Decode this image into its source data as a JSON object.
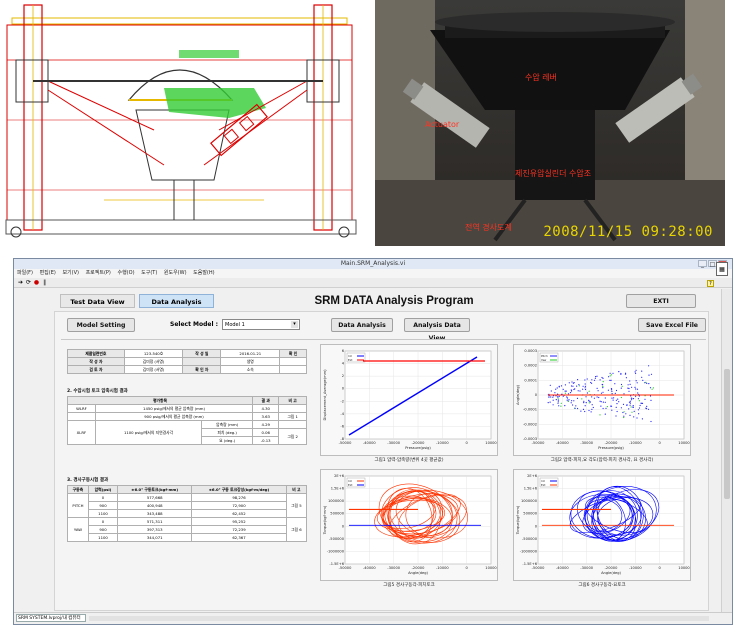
{
  "photo": {
    "label_top": "수압 레버",
    "label_actuator": "Actuator",
    "label_mid": "제진유압실린더 수압조",
    "label_bottom": "전역 경사도계",
    "timestamp": "2008/11/15 09:28:00"
  },
  "window": {
    "title": "Main.SRM_Analysis.vi",
    "menu": [
      "파일(F)",
      "편집(E)",
      "보기(V)",
      "프로젝트(P)",
      "수행(O)",
      "도구(T)",
      "윈도우(W)",
      "도움말(H)"
    ],
    "status_text": "SRM SYSTEM.lvproj/내 컴퓨터"
  },
  "tabs": {
    "test": "Test Data View",
    "analysis": "Data Analysis"
  },
  "program_title": "SRM DATA Analysis Program",
  "exit_label": "EXTI",
  "controls": {
    "model_setting": "Model Setting",
    "select_label": "Select Model :",
    "select_value": "Model 1",
    "data_analysis": "Data Analysis",
    "analysis_data_view": "Analysis Data View",
    "save_excel": "Save Excel File"
  },
  "info_table": {
    "rows": [
      [
        "제품일련번호",
        "123-540호",
        "작 성 일",
        "2016.01.21",
        "확 인"
      ],
      [
        "작 성 자",
        "김미정 (서명)",
        "",
        "생명",
        ""
      ],
      [
        "검 토 자",
        "김미정 (서명)",
        "확 인 자",
        "소속",
        ""
      ]
    ]
  },
  "section2": {
    "title": "2. 수압시험 토크 압축시험 결과",
    "headers": [
      "평가항목",
      "결 과",
      "비 고"
    ],
    "rows": [
      [
        "WLRF",
        "1450 psig/에서의 평균 압축량 (mm)",
        "",
        "4.30",
        ""
      ],
      [
        "",
        "900 psig/에서의 평균 압축량 (mm)",
        "",
        "3.63",
        "그림 1"
      ],
      [
        "XLRF",
        "1100 psig/에서의 지연경사각",
        "압축량 (mm)",
        "4.29",
        ""
      ],
      [
        "",
        "",
        "피치 (deg.)",
        "0.06",
        "그림 2"
      ],
      [
        "",
        "",
        "요 (deg.)",
        "-0.13",
        ""
      ]
    ]
  },
  "section3": {
    "title": "3. 경사구동시험 결과",
    "headers": [
      "구동축",
      "압력(psi)",
      "±6.0° 구동토크(kgf·mm)",
      "±6.0° 구동 토크강성(kgf·m/deg)",
      "비 고"
    ],
    "rows": [
      [
        "",
        "0",
        "577,668",
        "98,276",
        ""
      ],
      [
        "PITCH",
        "900",
        "400,948",
        "72,900",
        "그림 5"
      ],
      [
        "",
        "1100",
        "343,488",
        "62,452",
        ""
      ],
      [
        "",
        "0",
        "571,311",
        "95,252",
        ""
      ],
      [
        "YAW",
        "900",
        "397,313",
        "72,239",
        "그림 6"
      ],
      [
        "",
        "1100",
        "344,071",
        "62,367",
        ""
      ]
    ]
  },
  "plots": [
    {
      "ylabel": "Displacement_Average(mm)",
      "xlabel": "Pressure(psig)",
      "caption": "그림1 압력-압축량(변위 4곳 평균값)",
      "yticks": [
        "6",
        "4",
        "2",
        "0",
        "-2",
        "-4",
        "-6",
        "-8"
      ],
      "xticks": [
        "-50000",
        "-40000",
        "-30000",
        "-20000",
        "-10000",
        "0",
        "10000"
      ],
      "legend": [
        "Int",
        "Ext"
      ],
      "colors": [
        "#0000ff",
        "#ff0000"
      ]
    },
    {
      "ylabel": "Angle(deg)",
      "xlabel": "Pressure(psig)",
      "caption": "그림2 압력-피치,요 각도(압력-피치 경사각, 요 경사각)",
      "yticks": [
        "0.0003",
        "0.0002",
        "0.0001",
        "0",
        "-0.0001",
        "-0.0002",
        "-0.0003"
      ],
      "xticks": [
        "-50000",
        "-40000",
        "-30000",
        "-20000",
        "-10000",
        "0",
        "10000"
      ],
      "legend": [
        "Pitch",
        "Yaw"
      ],
      "colors": [
        "#2222ff",
        "#22cc22",
        "#ff2200"
      ]
    },
    {
      "ylabel": "Torque(kgf·mm)",
      "xlabel": "Angle(deg)",
      "caption": "그림5 경사구동각-피치토크",
      "yticks": [
        "2E+6",
        "1.5E+6",
        "1000000",
        "500000",
        "0",
        "-500000",
        "-1000000",
        "-1.5E+6"
      ],
      "xticks": [
        "-50000",
        "-40000",
        "-30000",
        "-20000",
        "-10000",
        "0",
        "10000"
      ],
      "legend": [
        "Int",
        "Ext"
      ],
      "colors": [
        "#ff3300",
        "#0000ff"
      ]
    },
    {
      "ylabel": "Torque(kgf·mm)",
      "xlabel": "Angle(deg)",
      "caption": "그림6 경사구동각-요토크",
      "yticks": [
        "2E+6",
        "1.5E+6",
        "1000000",
        "500000",
        "0",
        "-500000",
        "-1000000",
        "-1.5E+6"
      ],
      "xticks": [
        "-50000",
        "-40000",
        "-30000",
        "-20000",
        "-10000",
        "0",
        "10000"
      ],
      "legend": [
        "Int",
        "Ext"
      ],
      "colors": [
        "#0000ff",
        "#ff3300"
      ]
    }
  ]
}
